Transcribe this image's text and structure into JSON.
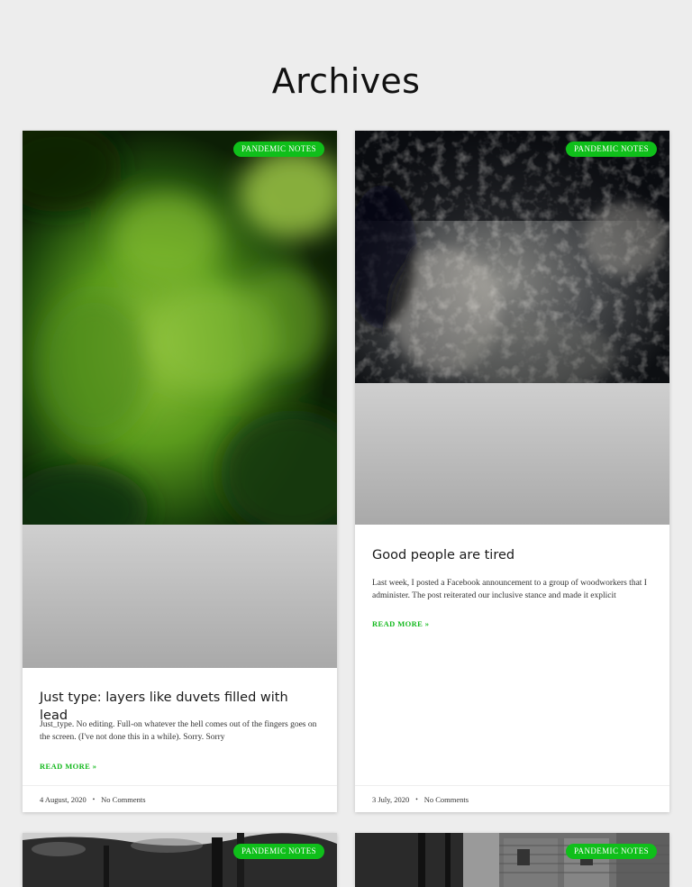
{
  "page": {
    "title": "Archives"
  },
  "posts": [
    {
      "category": "PANDEMIC NOTES",
      "title": "Just type: layers like duvets filled with lead",
      "excerpt": "Just_type. No editing. Full-on whatever the hell comes out of the fingers goes on the screen. (I've not done this in a while). Sorry. Sorry",
      "read_more": "READ MORE »",
      "date": "4 August, 2020",
      "comments": "No Comments",
      "image": "green-bokeh-image"
    },
    {
      "category": "PANDEMIC NOTES",
      "title": "Good people are tired",
      "excerpt": "Last week, I posted a Facebook announcement to a group of woodworkers that I administer. The post reiterated our inclusive stance and made it explicit",
      "read_more": "READ MORE »",
      "date": "3 July, 2020",
      "comments": "No Comments",
      "image": "dark-abstract-image"
    },
    {
      "category": "PANDEMIC NOTES",
      "image": "trees-bw-image"
    },
    {
      "category": "PANDEMIC NOTES",
      "image": "brick-building-bw-image"
    }
  ],
  "meta": {
    "separator": "•"
  },
  "colors": {
    "accent": "#13b91d",
    "badge": "#0fbf1a",
    "background": "#ededed"
  }
}
